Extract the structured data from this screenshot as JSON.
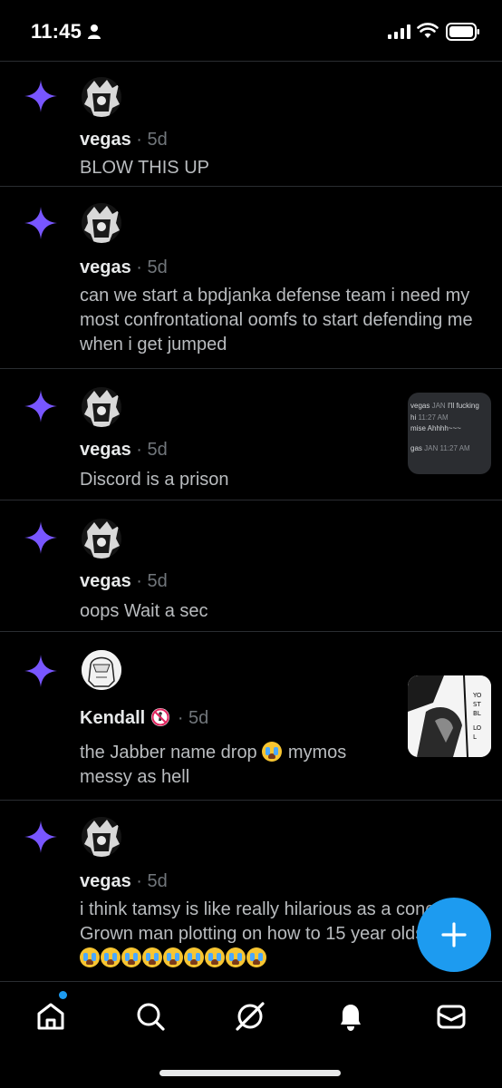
{
  "status_bar": {
    "time": "11:45"
  },
  "notifications": [
    {
      "username": "vegas",
      "separator": "·",
      "ago": "5d",
      "text": "BLOW THIS UP"
    },
    {
      "username": "vegas",
      "separator": "·",
      "ago": "5d",
      "text": "can we start a bpdjanka defense team i need my most confrontational oomfs to start defending me when i get jumped"
    },
    {
      "username": "vegas",
      "separator": "·",
      "ago": "5d",
      "text": "Discord is a prison",
      "thumbnail_lines": [
        {
          "name": "vegas",
          "tag": "JAN",
          "msg": "I'll fucking"
        },
        {
          "name": "hi",
          "tag": "",
          "msg": "11:27 AM"
        },
        {
          "name": "",
          "tag": "",
          "msg": "mise Ahhhh~~~"
        },
        {
          "name": "gas",
          "tag": "JAN",
          "msg": "11:27 AM"
        }
      ]
    },
    {
      "username": "vegas",
      "separator": "·",
      "ago": "5d",
      "text": "oops Wait a sec"
    },
    {
      "username": "Kendall",
      "separator": "·",
      "ago": "5d",
      "text_before": "the Jabber name drop",
      "text_after": "mymos messy as hell"
    },
    {
      "username": "vegas",
      "separator": "·",
      "ago": "5d",
      "text": "i think tamsy is like really hilarious as a concept. Grown man plotting on how to 15 year olds life"
    }
  ],
  "icons": {
    "sparkle": "sparkle-icon",
    "fab": "plus-icon",
    "tabs": [
      "home-icon",
      "search-icon",
      "feeds-icon",
      "notifications-icon",
      "messages-icon"
    ]
  },
  "colors": {
    "accent": "#1d9bf0",
    "sparkle": "#7856ff",
    "background": "#000000"
  }
}
